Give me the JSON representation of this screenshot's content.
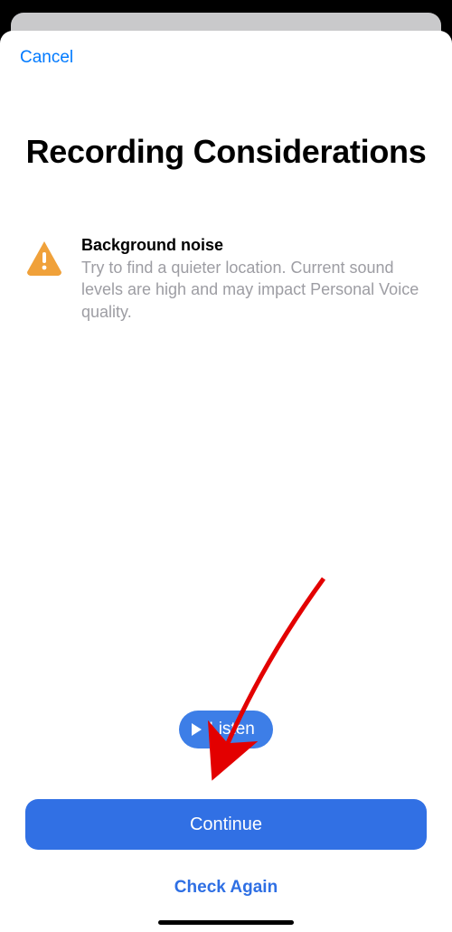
{
  "nav": {
    "cancel": "Cancel"
  },
  "title": "Recording Considerations",
  "item": {
    "heading": "Background noise",
    "body": "Try to find a quieter location. Current sound levels are high and may impact Personal Voice quality."
  },
  "listen": "Listen",
  "continue": "Continue",
  "check_again": "Check Again"
}
